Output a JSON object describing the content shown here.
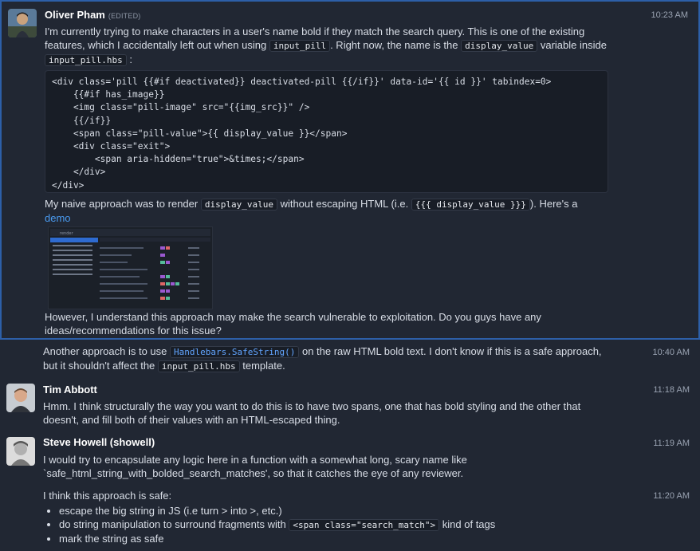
{
  "messages": {
    "m1": {
      "sender": "Oliver Pham",
      "edited": "(EDITED)",
      "time": "10:23 AM",
      "p1": {
        "a": "I'm currently trying to make characters in a user's name bold if they match the search query. This is one of the existing features, which I accidentally left out when using",
        "c1": "input_pill",
        "b": ". Right now, the name is the",
        "c2": "display_value",
        "c": "variable inside",
        "c3": "input_pill.hbs",
        "d": ":"
      },
      "code_lines": [
        "<div class='pill {{#if deactivated}} deactivated-pill {{/if}}' data-id='{{ id }}' tabindex=0>",
        "    {{#if has_image}}",
        "    <img class=\"pill-image\" src=\"{{img_src}}\" />",
        "    {{/if}}",
        "    <span class=\"pill-value\">{{ display_value }}</span>",
        "    <div class=\"exit\">",
        "        <span aria-hidden=\"true\">&times;</span>",
        "    </div>",
        "</div>"
      ],
      "p2": {
        "a": "My naive approach was to render",
        "c1": "display_value",
        "b": "without escaping HTML (i.e.",
        "c2": "{{{ display_value }}}",
        "c": "). Here's a",
        "link": "demo"
      },
      "thumb_search": "render",
      "p3": "However, I understand this approach may make the search vulnerable to exploitation. Do you guys have any ideas/recommendations for this issue?"
    },
    "m2": {
      "time": "10:40 AM",
      "a": "Another approach is to use",
      "c1": "Handlebars.SafeString()",
      "b": "on the raw HTML bold text. I don't know if this is a safe approach, but it shouldn't affect the",
      "c2": "input_pill.hbs",
      "c": "template."
    },
    "m3": {
      "sender": "Tim Abbott",
      "time": "11:18 AM",
      "text": "Hmm. I think structurally the way you want to do this is to have two spans, one that has bold styling and the other that doesn't, and fill both of their values with an HTML-escaped thing."
    },
    "m4": {
      "sender": "Steve Howell (showell)",
      "time": "11:19 AM",
      "text": "I would try to encapsulate any logic here in a function with a somewhat long, scary name like `safe_html_string_with_bolded_search_matches', so that it catches the eye of any reviewer."
    },
    "m5": {
      "time": "11:20 AM",
      "intro": "I think this approach is safe:",
      "b1": "escape the big string in JS (i.e turn > into >, etc.)",
      "b2a": "do string manipulation to surround fragments with",
      "b2c": "<span class=\"search_match\">",
      "b2b": "kind of tags",
      "b3": "mark the string as safe"
    }
  },
  "colors": {
    "background": "#212733",
    "selected_border": "#2d5fa8",
    "link": "#4a9bf0"
  }
}
